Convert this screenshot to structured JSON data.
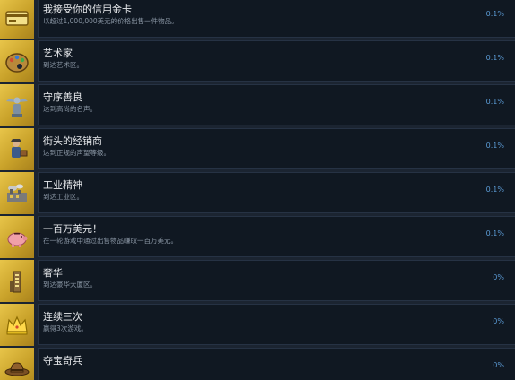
{
  "colors": {
    "background": "#1b2431",
    "panel": "#101822",
    "icon_gold": "#d4af37",
    "percent": "#5b9bd5",
    "title": "#e6e8eb",
    "description": "#8a96a4"
  },
  "achievements": [
    {
      "title": "我接受你的信用金卡",
      "description": "以超过1,000,000美元的价格出售一件物品。",
      "percent": "0.1%",
      "icon": "credit-card-icon"
    },
    {
      "title": "艺术家",
      "description": "到达艺术区。",
      "percent": "0.1%",
      "icon": "palette-icon"
    },
    {
      "title": "守序善良",
      "description": "达到高尚的名声。",
      "percent": "0.1%",
      "icon": "angel-statue-icon"
    },
    {
      "title": "街头的经销商",
      "description": "达到正规的声望等级。",
      "percent": "0.1%",
      "icon": "street-dealer-icon"
    },
    {
      "title": "工业精神",
      "description": "到达工业区。",
      "percent": "0.1%",
      "icon": "industry-icon"
    },
    {
      "title": "一百万美元！",
      "description": "在一轮游戏中通过出售物品赚取一百万美元。",
      "percent": "0.1%",
      "icon": "piggy-bank-icon"
    },
    {
      "title": "奢华",
      "description": "到达豪华大厦区。",
      "percent": "0%",
      "icon": "luxury-tower-icon"
    },
    {
      "title": "连续三次",
      "description": "赢得3次游戏。",
      "percent": "0%",
      "icon": "crown-icon"
    },
    {
      "title": "夺宝奇兵",
      "description": "",
      "percent": "0%",
      "icon": "explorer-hat-icon"
    }
  ]
}
